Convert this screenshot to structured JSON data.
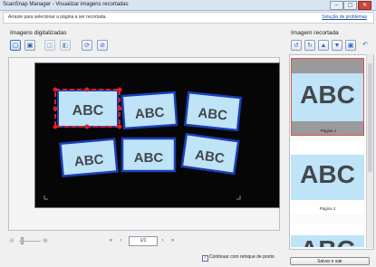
{
  "window": {
    "title": "ScanSnap Manager - Visualizar imagens recortadas",
    "minimize": "–",
    "maximize": "▢",
    "close": "✕"
  },
  "info": {
    "message": "Arraste para selecionar a página a ser recortada.",
    "link": "Solução de problemas"
  },
  "left": {
    "title": "Imagens digitalizadas"
  },
  "right": {
    "title": "Imagem recortada",
    "thumbnails": [
      {
        "label": "Página 1",
        "text": "ABC",
        "selected": true
      },
      {
        "label": "Página 2",
        "text": "ABC",
        "selected": false
      },
      {
        "label": "",
        "text": "ABC",
        "selected": false
      }
    ]
  },
  "preview": {
    "cards": [
      "ABC",
      "ABC",
      "ABC",
      "ABC",
      "ABC",
      "ABC"
    ]
  },
  "pager": {
    "value": "1/1"
  },
  "checkbox": {
    "label": "Continuar com retoque de ponto",
    "checked": true
  },
  "save_button": "Salvar e sair",
  "icons": {
    "first": "«",
    "prev": "‹",
    "next": "›",
    "last": "»",
    "zoom_out": "⊖",
    "zoom_in": "⊕"
  },
  "colors": {
    "accent": "#1a3fb8",
    "card": "#bfe3f7",
    "selection": "#e0201b"
  }
}
